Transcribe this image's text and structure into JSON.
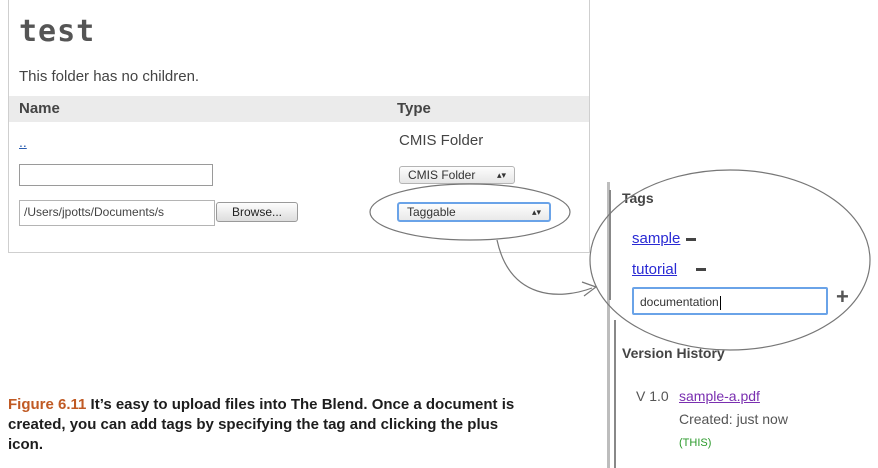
{
  "folder": {
    "title": "test",
    "empty_message": "This folder has no children.",
    "columns": {
      "name": "Name",
      "type": "Type"
    },
    "parent_link": "..",
    "parent_type": "CMIS Folder",
    "new_folder": {
      "name_value": "",
      "type_selected": "CMIS Folder"
    },
    "upload": {
      "file_path": "/Users/jpotts/Documents/s",
      "browse_label": "Browse...",
      "type_selected": "Taggable"
    }
  },
  "tags_panel": {
    "title": "Tags",
    "tags": [
      "sample",
      "tutorial"
    ],
    "new_tag_value": "documentation",
    "add_icon": "plus-icon",
    "remove_icon": "minus-icon"
  },
  "version_history": {
    "title": "Version History",
    "versions": [
      {
        "version": "V 1.0",
        "file": "sample-a.pdf",
        "created": "Created: just now",
        "badge": "(THIS)"
      }
    ]
  },
  "caption": {
    "figure_label": "Figure 6.11",
    "text": "It’s easy to upload files into The Blend. Once a document is created, you can add tags by specifying the tag and clicking the plus icon."
  },
  "colors": {
    "link": "#2a2ad4",
    "visited": "#7a2fb0",
    "focus": "#6aa3e8",
    "figure_label": "#c05a24",
    "badge": "#2b9a2b"
  }
}
